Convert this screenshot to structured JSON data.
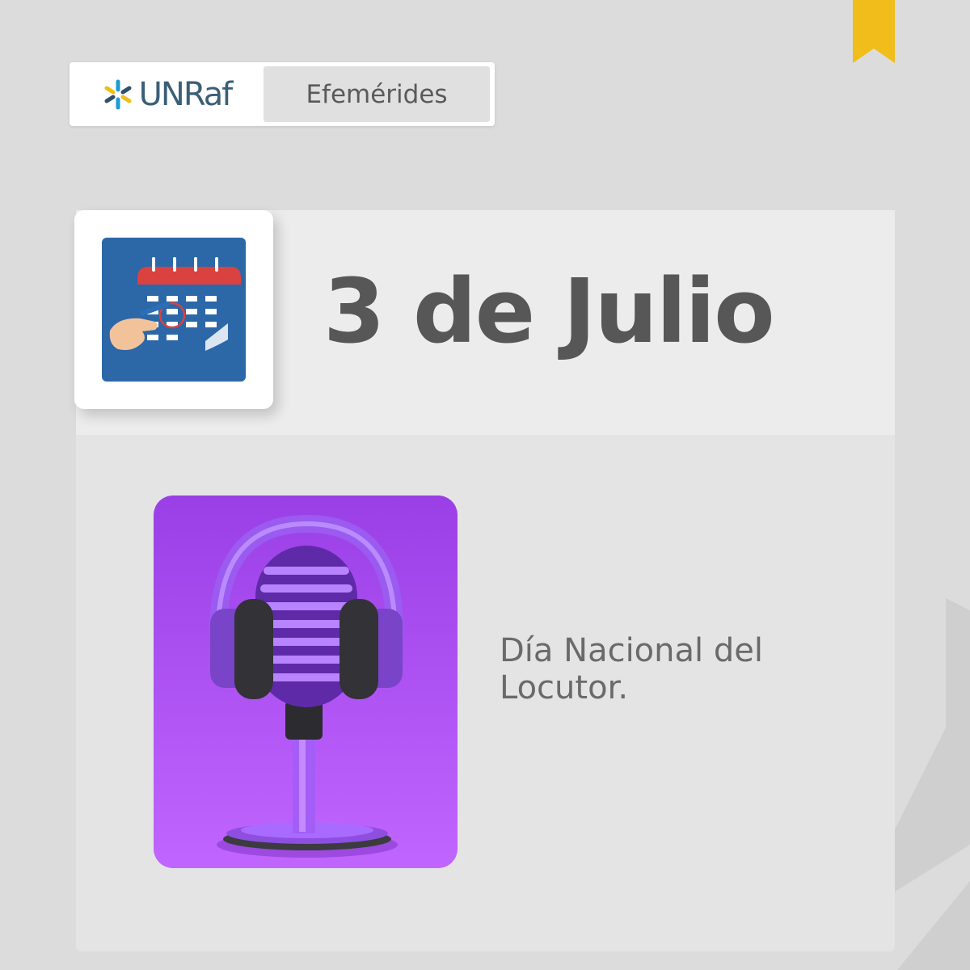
{
  "brand": {
    "logo_text": "UNRaf",
    "section_label": "Efemérides"
  },
  "date": {
    "label": "3 de Julio"
  },
  "event": {
    "description": "Día Nacional del Locutor."
  },
  "icons": {
    "logo": "asterisk-logo-icon",
    "calendar": "calendar-icon",
    "microphone": "microphone-headphones-image",
    "bookmark": "bookmark-icon"
  },
  "colors": {
    "background": "#dcdcdc",
    "accent_yellow": "#f0bd1b",
    "brand_blue": "#3a5f76",
    "calendar_blue": "#2c67a8",
    "calendar_red": "#d9423f",
    "purple": "#a74ff2",
    "text_gray": "#575757"
  }
}
